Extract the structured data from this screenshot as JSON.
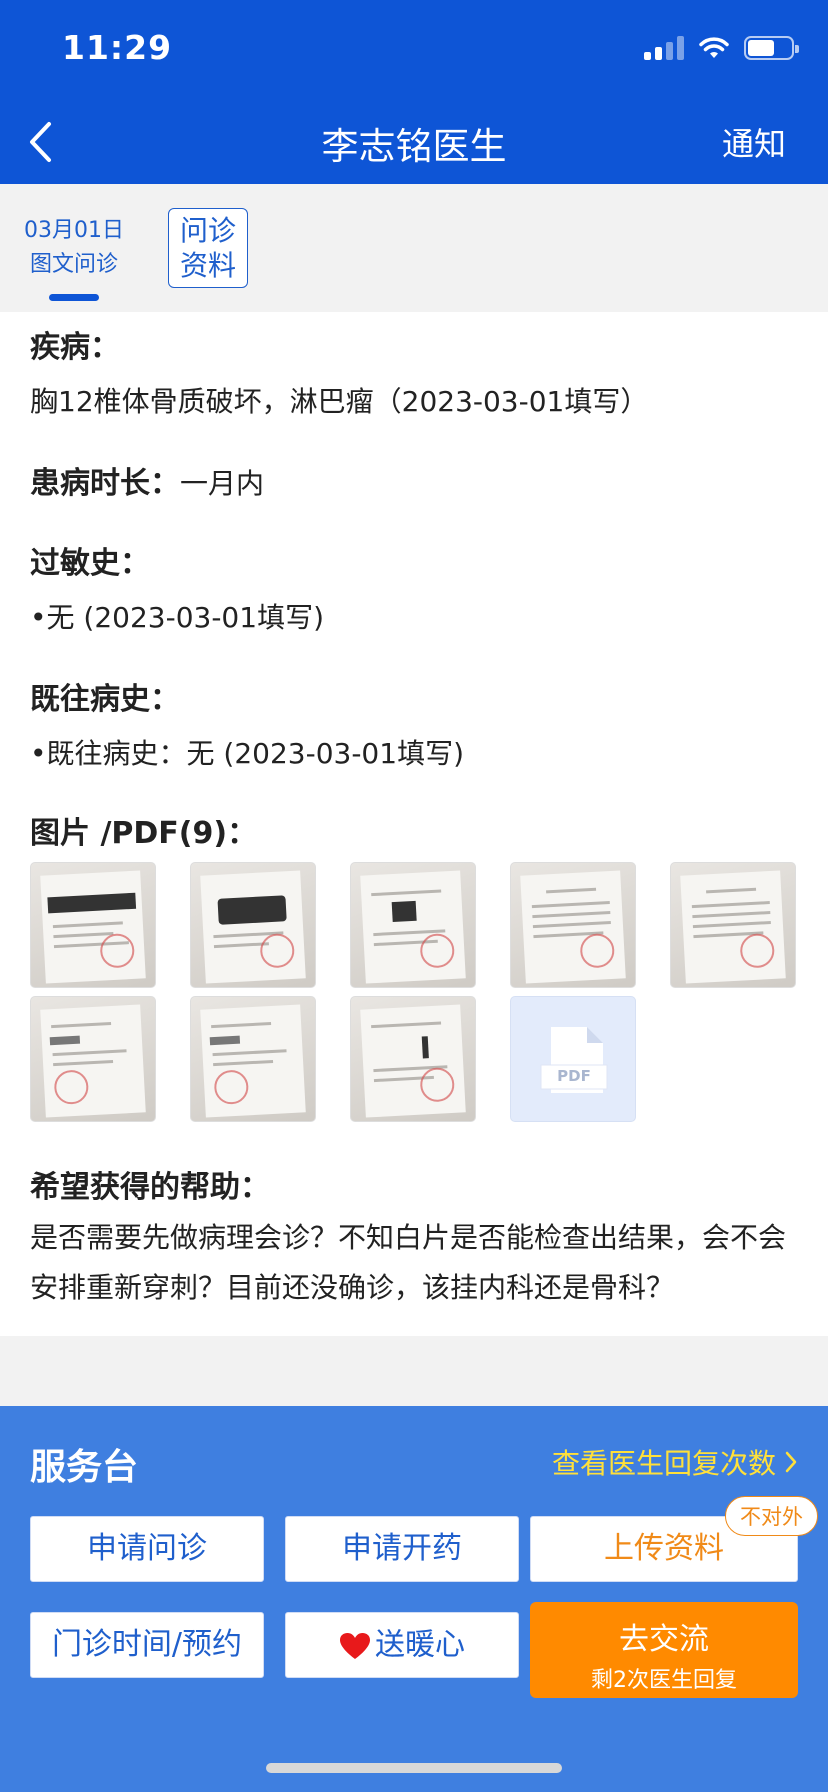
{
  "status_bar": {
    "time": "11:29"
  },
  "nav": {
    "title": "李志铭医生",
    "notify_label": "通知"
  },
  "tabs": {
    "date": "03月01日",
    "type": "图文问诊",
    "info_line1": "问诊",
    "info_line2": "资料"
  },
  "consult": {
    "disease_label": "疾病：",
    "disease_value": "胸12椎体骨质破坏，淋巴瘤（2023-03-01填写）",
    "duration_label": "患病时长：",
    "duration_value": "一月内",
    "allergy_label": "过敏史：",
    "allergy_value": "•无 (2023-03-01填写)",
    "history_label": "既往病史：",
    "history_value": "•既往病史：无 (2023-03-01填写)",
    "images_label": "图片 /PDF(9)：",
    "pdf_label": "PDF",
    "help_label": "希望获得的帮助：",
    "help_text": "是否需要先做病理会诊？不知白片是否能检查出结果，会不会安排重新穿刺？目前还没确诊，该挂内科还是骨科？"
  },
  "service": {
    "title": "服务台",
    "reply_link": "查看医生回复次数",
    "apply_consult": "申请问诊",
    "apply_medicine": "申请开药",
    "upload": "上传资料",
    "badge": "不对外",
    "clinic": "门诊时间/预约",
    "warmth": "送暖心",
    "chat_main": "去交流",
    "chat_sub": "剩2次医生回复"
  },
  "colors": {
    "header_bg": "#0e55d6",
    "service_bg": "#3f7fe0",
    "accent_orange": "#ff8a00",
    "link_yellow": "#ffe03a"
  }
}
